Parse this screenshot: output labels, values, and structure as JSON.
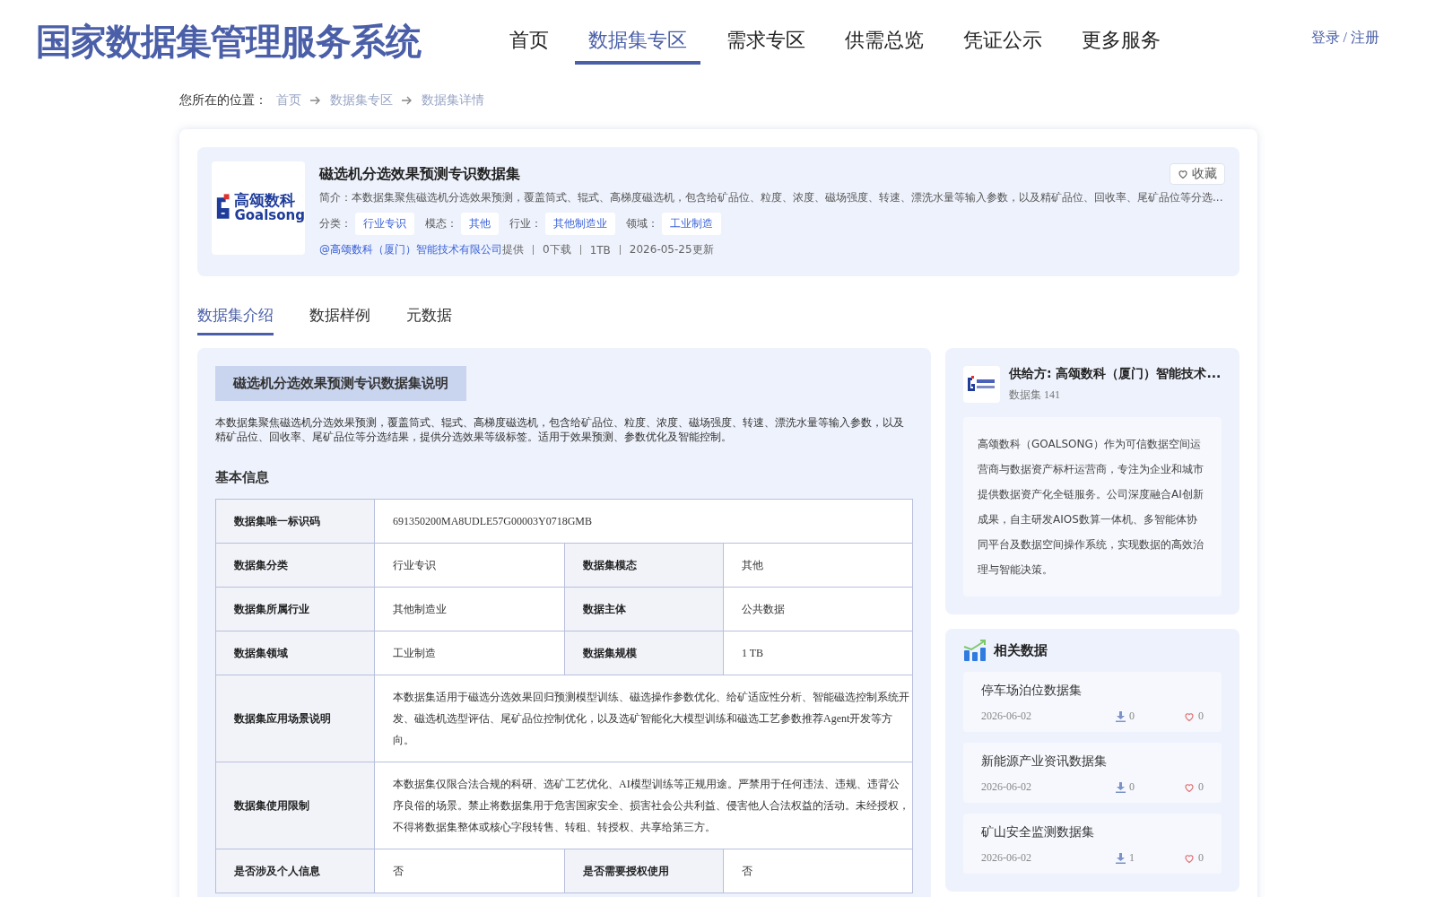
{
  "site_title": "国家数据集管理服务系统",
  "nav": [
    {
      "label": "首页",
      "selected": false
    },
    {
      "label": "数据集专区",
      "selected": true
    },
    {
      "label": "需求专区",
      "selected": false
    },
    {
      "label": "供需总览",
      "selected": false
    },
    {
      "label": "凭证公示",
      "selected": false
    },
    {
      "label": "更多服务",
      "selected": false
    }
  ],
  "auth_link": "登录 / 注册",
  "breadcrumb": {
    "prefix": "您所在的位置：",
    "items": [
      "首页",
      "数据集专区",
      "数据集详情"
    ]
  },
  "dataset": {
    "logo": {
      "name": "高颂数科",
      "latin": "Goalsong"
    },
    "title": "磁选机分选效果预测专识数据集",
    "favorite": {
      "label": "收藏",
      "selected": false
    },
    "summary": "简介：本数据集聚焦磁选机分选效果预测，覆盖筒式、辊式、高梯度磁选机，包含给矿品位、粒度、浓度、磁场强度、转速、漂洗水量等输入参数，以及精矿品位、回收率、尾矿品位等分选...",
    "tags": [
      {
        "label": "分类：",
        "value": "行业专识"
      },
      {
        "label": "模态：",
        "value": "其他"
      },
      {
        "label": "行业：",
        "value": "其他制造业"
      },
      {
        "label": "领域：",
        "value": "工业制造"
      }
    ],
    "provider": "@高颂数科（厦门）智能技术有限公司",
    "provider_suffix": "提供",
    "stats": [
      "0下载",
      "1TB",
      "2026-05-25更新"
    ]
  },
  "tabs": [
    {
      "label": "数据集介绍",
      "selected": true
    },
    {
      "label": "数据样例",
      "selected": false
    },
    {
      "label": "元数据",
      "selected": false
    }
  ],
  "intro": {
    "heading": "磁选机分选效果预测专识数据集说明",
    "text": "本数据集聚焦磁选机分选效果预测，覆盖筒式、辊式、高梯度磁选机，包含给矿品位、粒度、浓度、磁场强度、转速、漂洗水量等输入参数，以及精矿品位、回收率、尾矿品位等分选结果，提供分选效果等级标签。适用于效果预测、参数优化及智能控制。"
  },
  "basic_info": {
    "title": "基本信息",
    "rows": [
      [
        {
          "label": "数据集唯一标识码",
          "value": "691350200MA8UDLE57G00003Y0718GMB"
        }
      ],
      [
        {
          "label": "数据集分类",
          "value": "行业专识"
        },
        {
          "label": "数据集模态",
          "value": "其他"
        }
      ],
      [
        {
          "label": "数据集所属行业",
          "value": "其他制造业"
        },
        {
          "label": "数据主体",
          "value": "公共数据"
        }
      ],
      [
        {
          "label": "数据集领域",
          "value": "工业制造"
        },
        {
          "label": "数据集规模",
          "value": "1 TB"
        }
      ],
      [
        {
          "label": "数据集应用场景说明",
          "value": "本数据集适用于磁选分选效果回归预测模型训练、磁选操作参数优化、给矿适应性分析、智能磁选控制系统开发、磁选机选型评估、尾矿品位控制优化，以及选矿智能化大模型训练和磁选工艺参数推荐Agent开发等方向。"
        }
      ],
      [
        {
          "label": "数据集使用限制",
          "value": "本数据集仅限合法合规的科研、选矿工艺优化、AI模型训练等正规用途。严禁用于任何违法、违规、违背公序良俗的场景。禁止将数据集用于危害国家安全、损害社会公共利益、侵害他人合法权益的活动。未经授权，不得将数据集整体或核心字段转售、转租、转授权、共享给第三方。"
        }
      ],
      [
        {
          "label": "是否涉及个人信息",
          "value": "否"
        },
        {
          "label": "是否需要授权使用",
          "value": "否"
        }
      ]
    ]
  },
  "supplier": {
    "name": "供给方: 高颂数科（厦门）智能技术...",
    "count": "数据集 141",
    "description": "高颂数科（GOALSONG）作为可信数据空间运营商与数据资产标杆运营商，专注为企业和城市提供数据资产化全链服务。公司深度融合AI创新成果，自主研发AIOS数算一体机、多智能体协同平台及数据空间操作系统，实现数据的高效治理与智能决策。"
  },
  "related": {
    "title": "相关数据",
    "items": [
      {
        "name": "停车场泊位数据集",
        "date": "2026-06-02",
        "downloads": "0",
        "likes": "0"
      },
      {
        "name": "新能源产业资讯数据集",
        "date": "2026-06-02",
        "downloads": "0",
        "likes": "0"
      },
      {
        "name": "矿山安全监测数据集",
        "date": "2026-06-02",
        "downloads": "1",
        "likes": "0"
      }
    ]
  }
}
